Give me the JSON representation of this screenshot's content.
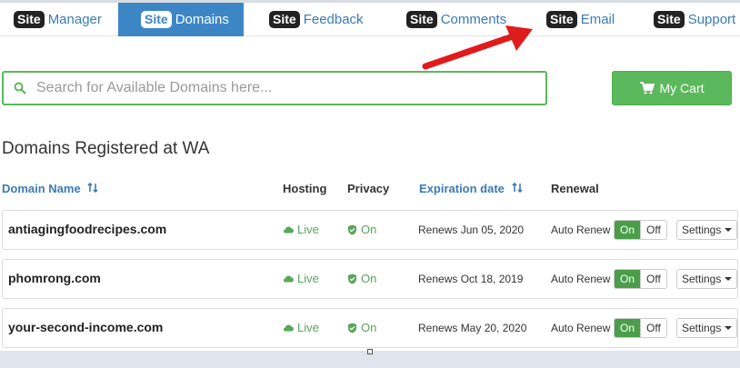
{
  "nav": {
    "badge": "Site",
    "tabs": [
      {
        "label": "Manager",
        "active": false
      },
      {
        "label": "Domains",
        "active": true
      },
      {
        "label": "Feedback",
        "active": false
      },
      {
        "label": "Comments",
        "active": false
      },
      {
        "label": "Email",
        "active": false
      },
      {
        "label": "Support",
        "active": false
      }
    ]
  },
  "search": {
    "placeholder": "Search for Available Domains here...",
    "value": ""
  },
  "cart": {
    "label": "My Cart"
  },
  "heading": "Domains Registered at WA",
  "table": {
    "headers": {
      "domain": "Domain Name",
      "hosting": "Hosting",
      "privacy": "Privacy",
      "expiration": "Expiration date",
      "renewal": "Renewal"
    },
    "rows": [
      {
        "domain": "antiagingfoodrecipes.com",
        "hosting": "Live",
        "privacy": "On",
        "expiration": "Renews Jun 05, 2020",
        "renewal": "Auto Renew",
        "on": "On",
        "off": "Off",
        "settings": "Settings"
      },
      {
        "domain": "phomrong.com",
        "hosting": "Live",
        "privacy": "On",
        "expiration": "Renews Oct 18, 2019",
        "renewal": "Auto Renew",
        "on": "On",
        "off": "Off",
        "settings": "Settings"
      },
      {
        "domain": "your-second-income.com",
        "hosting": "Live",
        "privacy": "On",
        "expiration": "Renews May 20, 2020",
        "renewal": "Auto Renew",
        "on": "On",
        "off": "Off",
        "settings": "Settings"
      }
    ]
  },
  "colors": {
    "accent": "#3d86c6",
    "success": "#5cb85c",
    "arrow": "#e01b1b"
  }
}
